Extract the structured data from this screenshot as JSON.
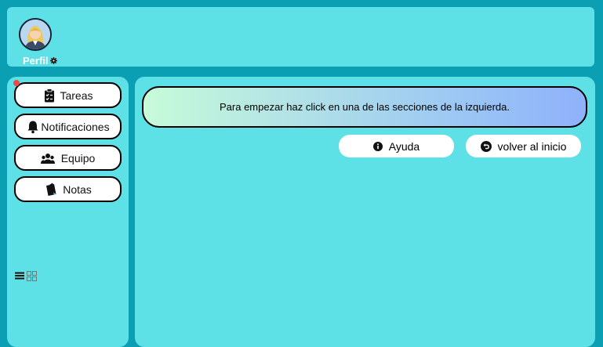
{
  "header": {
    "profile_label": "Perfil",
    "avatar_icon": "user-avatar-icon",
    "settings_icon": "gear-icon"
  },
  "sidebar": {
    "items": [
      {
        "label": "Tareas",
        "icon": "clipboard-check-icon",
        "has_notification_dot": true
      },
      {
        "label": "Notificaciones",
        "icon": "bell-icon"
      },
      {
        "label": "Equipo",
        "icon": "users-icon"
      },
      {
        "label": "Notas",
        "icon": "notes-icon"
      }
    ],
    "view_toggle": {
      "list_icon": "list-icon",
      "grid_icon": "grid-icon"
    }
  },
  "main": {
    "banner_text": "Para empezar haz click en una de las secciones de la izquierda.",
    "help_label": "Ayuda",
    "home_label": "volver al inicio"
  },
  "colors": {
    "background": "#0a9fb3",
    "panel": "#5de1e6",
    "notification_dot": "#e84b4b",
    "banner_gradient_start": "#c7fbd9",
    "banner_gradient_end": "#8fb1fb"
  }
}
